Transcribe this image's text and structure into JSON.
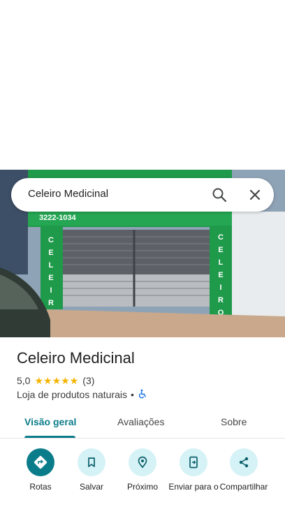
{
  "search": {
    "query": "Celeiro Medicinal",
    "search_icon": "search-icon",
    "close_icon": "close-icon"
  },
  "photo": {
    "storefront_sign_phone": "3222-1034",
    "storefront_side_letters": [
      "C",
      "E",
      "L",
      "E",
      "I",
      "R",
      "O"
    ]
  },
  "place": {
    "name": "Celeiro Medicinal",
    "rating": "5,0",
    "stars": 5,
    "review_count": "(3)",
    "category": "Loja de produtos naturais",
    "separator": "•",
    "accessibility_icon": "wheelchair-icon"
  },
  "tabs": [
    {
      "label": "Visão geral",
      "active": true
    },
    {
      "label": "Avaliações",
      "active": false
    },
    {
      "label": "Sobre",
      "active": false
    }
  ],
  "actions": [
    {
      "label": "Rotas",
      "icon": "directions-icon"
    },
    {
      "label": "Salvar",
      "icon": "bookmark-icon"
    },
    {
      "label": "Próximo",
      "icon": "nearby-icon"
    },
    {
      "label": "Enviar para o",
      "icon": "send-to-phone-icon"
    },
    {
      "label": "Compartilhar",
      "icon": "share-icon"
    }
  ],
  "colors": {
    "accent": "#0b7d8a",
    "accent_light": "#d5f2f6",
    "star": "#f6b300",
    "storefront_green": "#1f9a4a"
  }
}
